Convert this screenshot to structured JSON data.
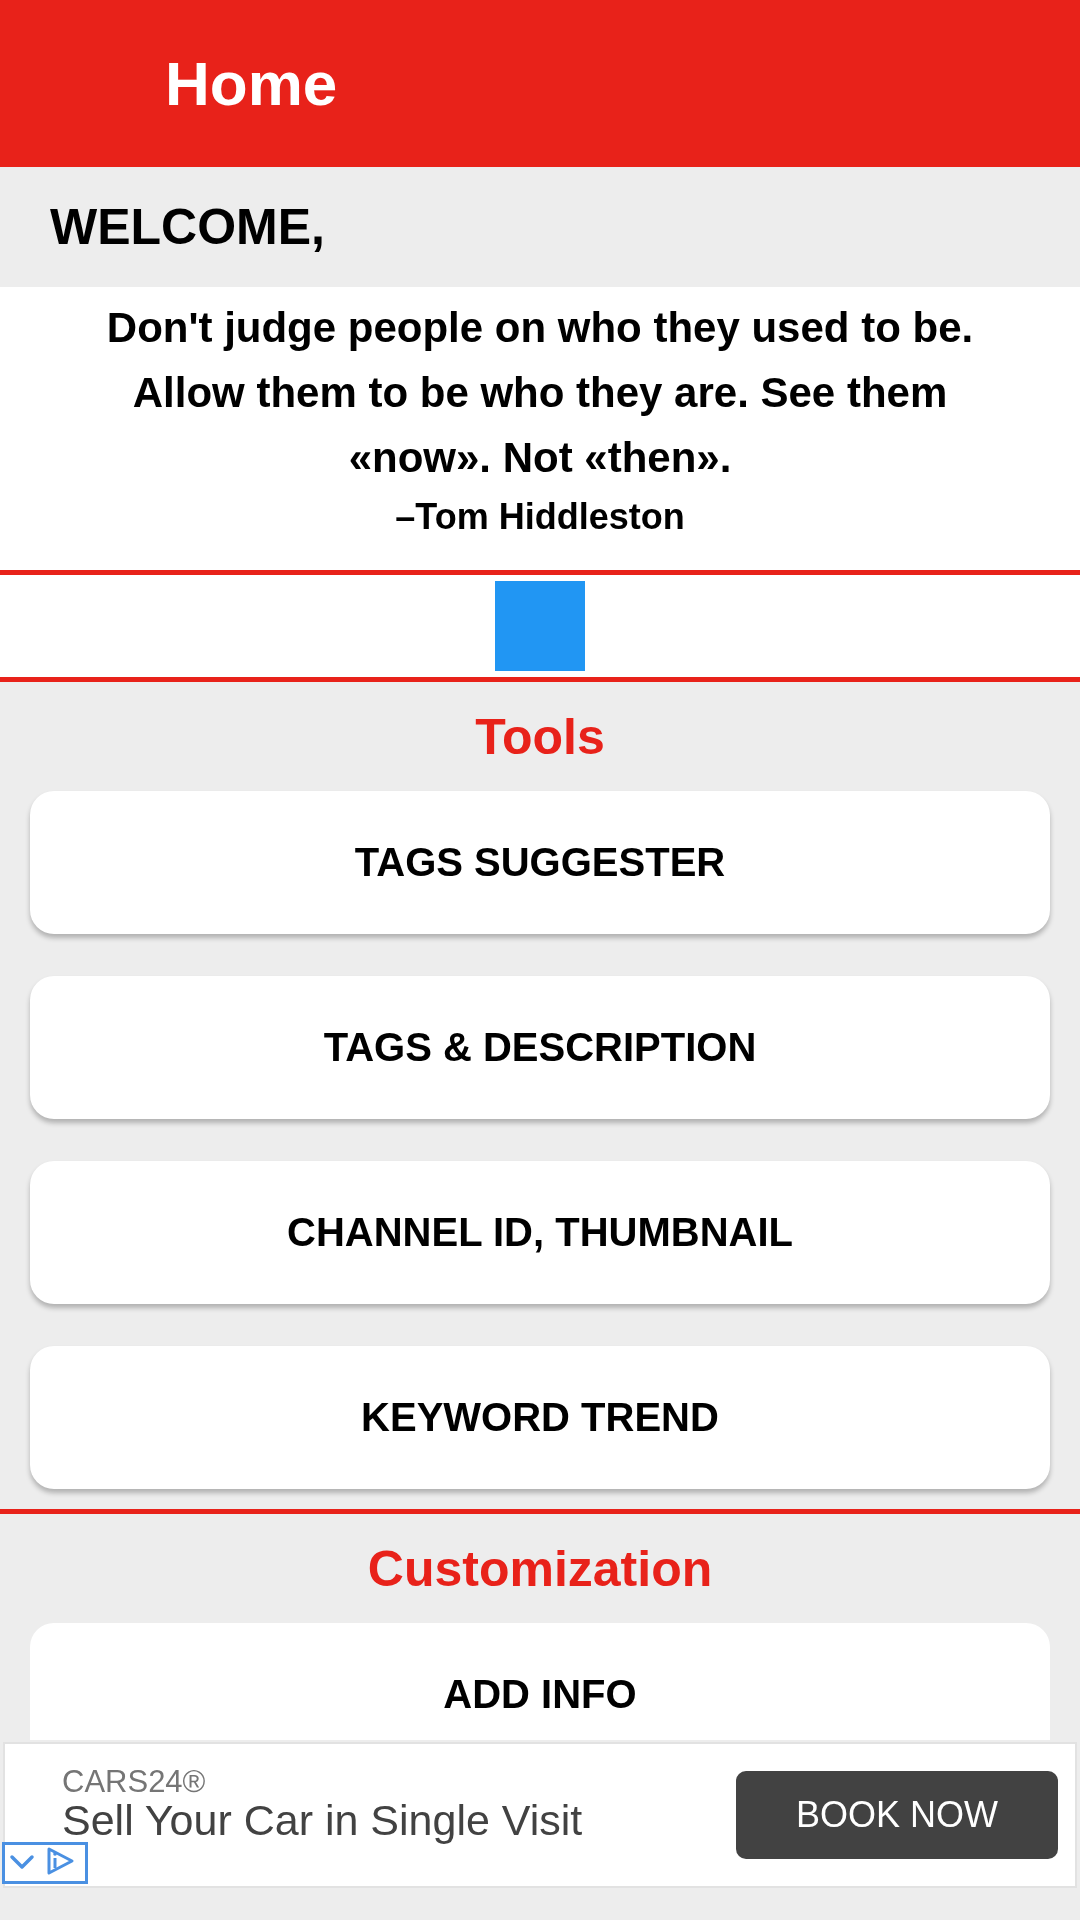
{
  "app_bar": {
    "title": "Home"
  },
  "welcome": {
    "text": "WELCOME,"
  },
  "quote": {
    "text": "Don't judge people on who they used to be. Allow them to be who they are. See them «now». Not «then».",
    "author": "–Tom Hiddleston"
  },
  "sections": [
    {
      "title": "Tools",
      "buttons": [
        "TAGS SUGGESTER",
        "TAGS & DESCRIPTION",
        "CHANNEL ID, THUMBNAIL",
        "KEYWORD TREND"
      ]
    },
    {
      "title": "Customization",
      "buttons": [
        "ADD INFO"
      ]
    }
  ],
  "ad": {
    "brand": "CARS24®",
    "headline": "Sell Your Car in Single Visit",
    "button": "BOOK NOW"
  }
}
